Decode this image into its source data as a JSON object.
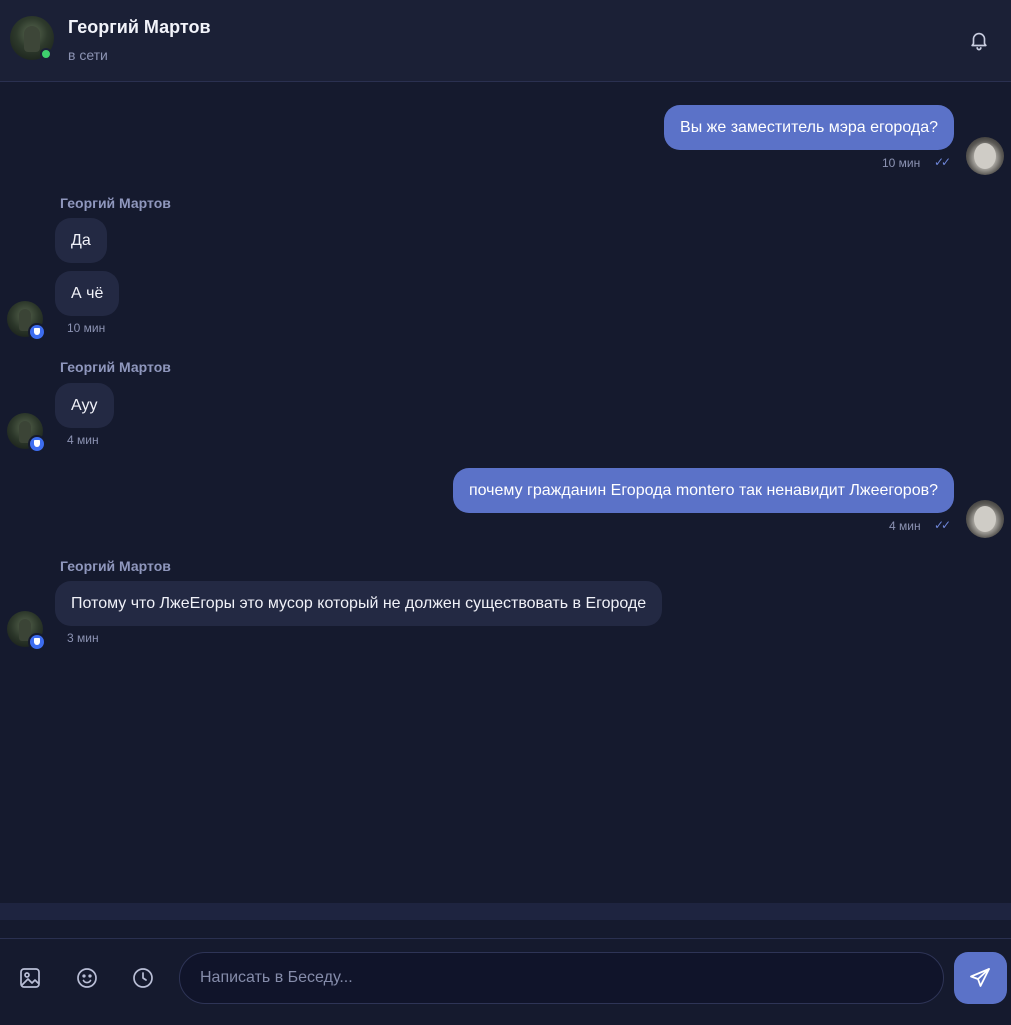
{
  "header": {
    "name": "Георгий Мартов",
    "status": "в сети"
  },
  "messages": [
    {
      "direction": "out",
      "text": "Вы же заместитель мэра егорода?",
      "time": "10 мин",
      "checks": "✓✓"
    },
    {
      "direction": "in",
      "sender": "Георгий Мартов",
      "texts": [
        "Да",
        "А чё"
      ],
      "time": "10 мин"
    },
    {
      "direction": "in",
      "sender": "Георгий Мартов",
      "texts": [
        "Ауу"
      ],
      "time": "4 мин"
    },
    {
      "direction": "out",
      "text": "почему гражданин Егорода  montero так ненавидит Лжеегоров?",
      "time": "4 мин",
      "checks": "✓✓"
    },
    {
      "direction": "in",
      "sender": "Георгий Мартов",
      "texts": [
        "Потому что ЛжеЕгоры это мусор который не должен существовать в Егороде"
      ],
      "time": "3 мин"
    }
  ],
  "composer": {
    "placeholder": "Написать в Беседу..."
  },
  "colors": {
    "background": "#151a2e",
    "outgoing_bubble": "#5b72c8",
    "incoming_bubble": "#232943",
    "online": "#3ecf6e",
    "badge": "#3d6df0"
  },
  "icons": [
    "bell-icon",
    "image-icon",
    "emoji-icon",
    "clock-icon",
    "send-icon",
    "shield-badge-icon",
    "double-check-icon"
  ]
}
